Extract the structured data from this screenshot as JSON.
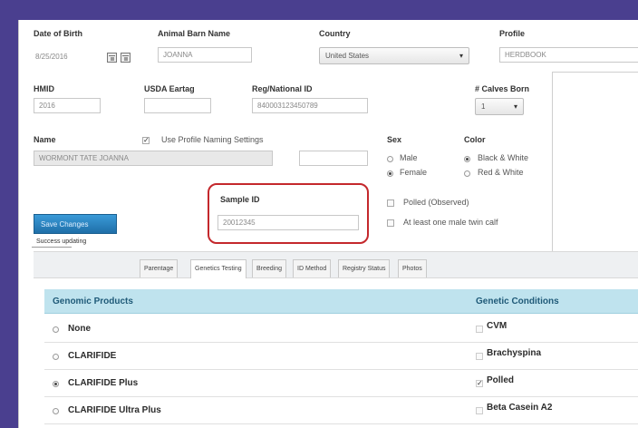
{
  "form": {
    "date_of_birth": {
      "label": "Date of Birth",
      "value": "8/25/2016"
    },
    "animal_barn_name": {
      "label": "Animal Barn Name",
      "value": "JOANNA"
    },
    "country": {
      "label": "Country",
      "value": "United States"
    },
    "profile": {
      "label": "Profile",
      "value": "HERDBOOK"
    },
    "hmid": {
      "label": "HMID",
      "value": "2016"
    },
    "usda_eartag": {
      "label": "USDA Eartag",
      "value": ""
    },
    "reg_national_id": {
      "label": "Reg/National ID",
      "value": "840003123450789"
    },
    "calves_born": {
      "label": "# Calves Born",
      "value": "1"
    },
    "name": {
      "label": "Name",
      "value": "WORMONT TATE JOANNA"
    },
    "use_profile_naming": {
      "label": "Use Profile Naming Settings",
      "checked": true
    },
    "sex": {
      "label": "Sex",
      "options": [
        "Male",
        "Female"
      ],
      "selected": "Female"
    },
    "color": {
      "label": "Color",
      "options": [
        "Black & White",
        "Red & White"
      ],
      "selected": "Black & White"
    },
    "sample_id": {
      "label": "Sample ID",
      "value": "20012345"
    },
    "polled_observed": {
      "label": "Polled (Observed)",
      "checked": false
    },
    "male_twin_calf": {
      "label": "At least one male twin calf",
      "checked": false
    }
  },
  "actions": {
    "save_label": "Save Changes",
    "status_text": "Success updating"
  },
  "tabs": [
    "Parentage",
    "Genetics Testing",
    "Breeding",
    "ID Method",
    "Registry Status",
    "Photos"
  ],
  "active_tab": "Genetics Testing",
  "genomic": {
    "products_header": "Genomic Products",
    "conditions_header": "Genetic Conditions",
    "products": [
      {
        "label": "None",
        "selected": false
      },
      {
        "label": "CLARIFIDE",
        "selected": false
      },
      {
        "label": "CLARIFIDE Plus",
        "selected": true
      },
      {
        "label": "CLARIFIDE Ultra Plus",
        "selected": false
      }
    ],
    "conditions": [
      {
        "label": "CVM",
        "checked": false
      },
      {
        "label": "Brachyspina",
        "checked": false
      },
      {
        "label": "Polled",
        "checked": true
      },
      {
        "label": "Beta Casein A2",
        "checked": false
      }
    ]
  },
  "colors": {
    "accent": "#1f6fa8",
    "highlight": "#c4282c",
    "header_bg": "#bfe3ee",
    "frame": "#4a3f8f"
  }
}
